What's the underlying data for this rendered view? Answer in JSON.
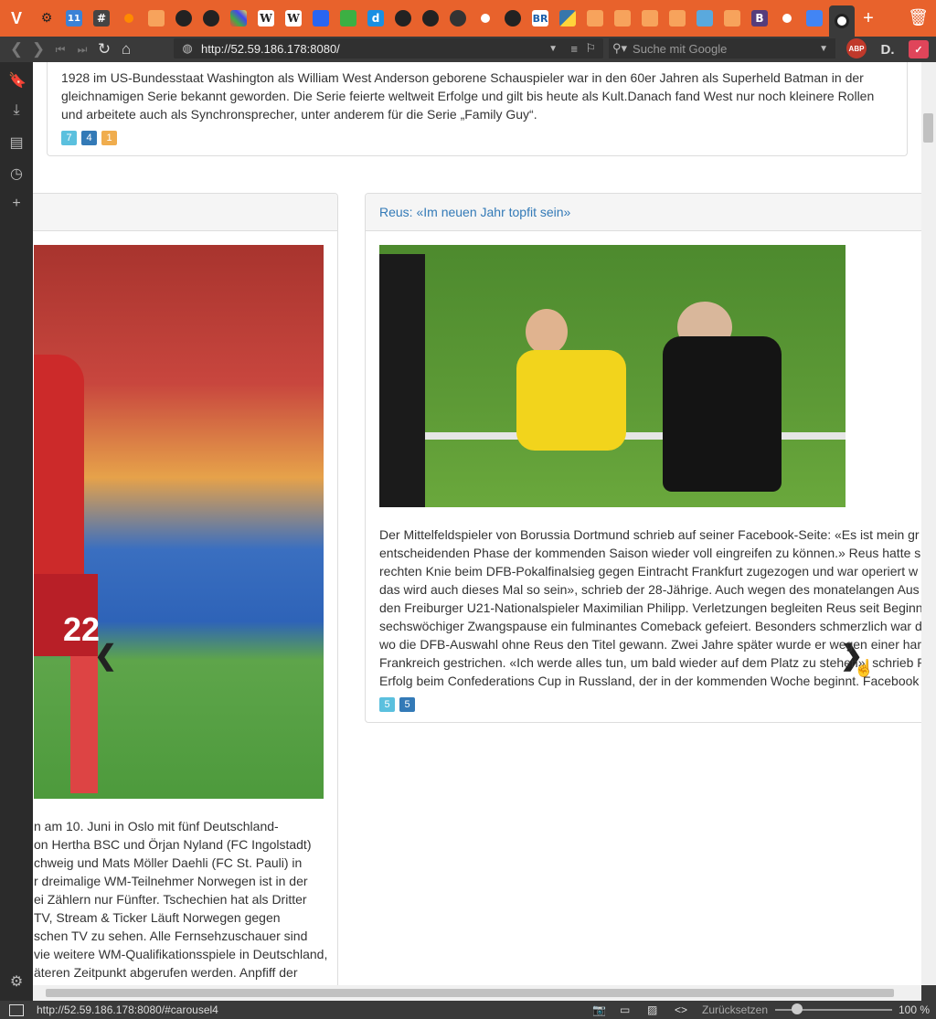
{
  "browser": {
    "url": "http://52.59.186.178:8080/",
    "search_placeholder": "Suche mit Google",
    "status_url": "http://52.59.186.178:8080/#carousel4",
    "reset_label": "Zurücksetzen",
    "zoom": "100 %",
    "tab_icons": [
      "vivaldi-icon",
      "tab-icon-1",
      "calendar-tab-icon",
      "hashtag-tab-icon",
      "orange-dot-tab-icon",
      "rss-tab-icon",
      "github-tab-icon",
      "github-tab-icon",
      "grid-tab-icon",
      "wikipedia-tab-icon",
      "wikipedia-tab-icon",
      "html5-tab-icon",
      "green-tab-icon",
      "d-tab-icon",
      "github-tab-icon",
      "github-tab-icon",
      "pin-tab-icon",
      "orange-circle-tab-icon",
      "github-tab-icon",
      "br-tab-icon",
      "python-tab-icon",
      "rss-tab-icon",
      "rss-tab-icon",
      "rss-tab-icon",
      "rss-tab-icon",
      "twitter-tab-icon",
      "rss-tab-icon",
      "bootstrap-tab-icon",
      "orange-circle-tab-icon",
      "docs-tab-icon",
      "active-tab-icon"
    ],
    "tab_labels": {
      "calendar": "11",
      "wiki": "W",
      "br": "BR",
      "bootstrap": "B",
      "hash": "#",
      "d": "d"
    },
    "ext_abp": "ABP",
    "ext_d": "D."
  },
  "top_article": {
    "line1": "1928 im US-Bundesstaat Washington als William West Anderson geborene Schauspieler war in den 60er Jahren als Superheld Batman in der",
    "line2": "gleichnamigen Serie bekannt geworden. Die Serie feierte weltweit Erfolge und gilt bis heute als Kult.Danach fand West nur noch kleinere Rollen",
    "line3": "und arbeitete auch als Synchronsprecher, unter anderem für die Serie „Family Guy“.",
    "badges": [
      "7",
      "4",
      "1"
    ]
  },
  "left_card": {
    "lines": [
      "n am 10. Juni in Oslo mit fünf Deutschland-",
      "on Hertha BSC und Örjan Nyland (FC Ingolstadt)",
      "chweig und Mats Möller Daehli (FC St. Pauli) in",
      "r dreimalige WM-Teilnehmer Norwegen ist in der",
      "ei Zählern nur Fünfter. Tschechien hat als Dritter",
      "TV, Stream & Ticker Läuft Norwegen gegen",
      "schen TV zu sehen. Alle Fernsehzuschauer sind",
      "vie weitere WM-Qualifikationsspiele in Deutschland,",
      "äteren Zeitpunkt abgerufen werden. Anpfiff der"
    ]
  },
  "right_card": {
    "title": "Reus: «Im neuen Jahr topfit sein»",
    "lines": [
      "Der Mittelfeldspieler von Borussia Dortmund schrieb auf seiner Facebook-Seite: «Es ist mein gr",
      "entscheidenden Phase der kommenden Saison wieder voll eingreifen zu können.» Reus hatte s",
      "rechten Knie beim DFB-Pokalfinalsieg gegen Eintracht Frankfurt zugezogen und war operiert w",
      "das wird auch dieses Mal so sein», schrieb der 28-Jährige. Auch wegen des monatelangen Aus",
      "den Freiburger U21-Nationalspieler Maximilian Philipp. Verletzungen begleiten Reus seit Beginn",
      "sechswöchiger Zwangspause ein fulminantes Comeback gefeiert. Besonders schmerzlich war d",
      "wo die DFB-Auswahl ohne Reus den Titel gewann. Zwei Jahre später wurde er wegen einer har",
      "Frankreich gestrichen. «Ich werde alles tun, um bald wieder auf dem Platz zu stehen», schrieb R",
      "Erfolg beim Confederations Cup in Russland, der in der kommenden Woche beginnt. Facebook"
    ],
    "badges": [
      "5",
      "5"
    ]
  },
  "colors": {
    "tabbar": "#e8622c",
    "link": "#337ab7"
  }
}
